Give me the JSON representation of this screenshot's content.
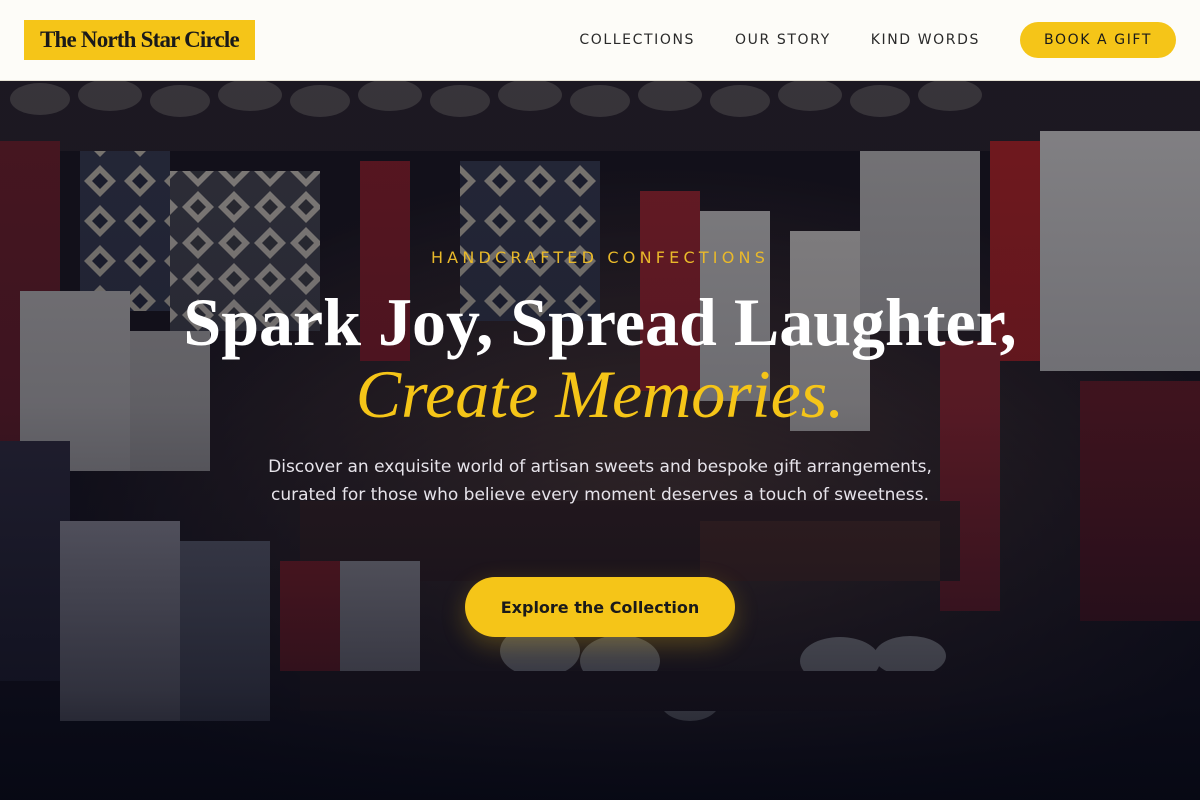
{
  "brand": {
    "name": "The North Star Circle"
  },
  "nav": {
    "items": [
      {
        "label": "COLLECTIONS"
      },
      {
        "label": "OUR STORY"
      },
      {
        "label": "KIND WORDS"
      }
    ],
    "cta_label": "BOOK A GIFT"
  },
  "hero": {
    "eyebrow": "HANDCRAFTED CONFECTIONS",
    "headline_line1": "Spark Joy, Spread Laughter,",
    "headline_line2": "Create Memories.",
    "description": "Discover an exquisite world of artisan sweets and bespoke gift arrangements, curated for those who believe every moment deserves a touch of sweetness.",
    "cta_label": "Explore the Collection"
  },
  "colors": {
    "accent": "#f5c518",
    "header_bg": "#fdfcf8",
    "hero_overlay": "#0a0c1c",
    "text_light": "#ffffff"
  }
}
